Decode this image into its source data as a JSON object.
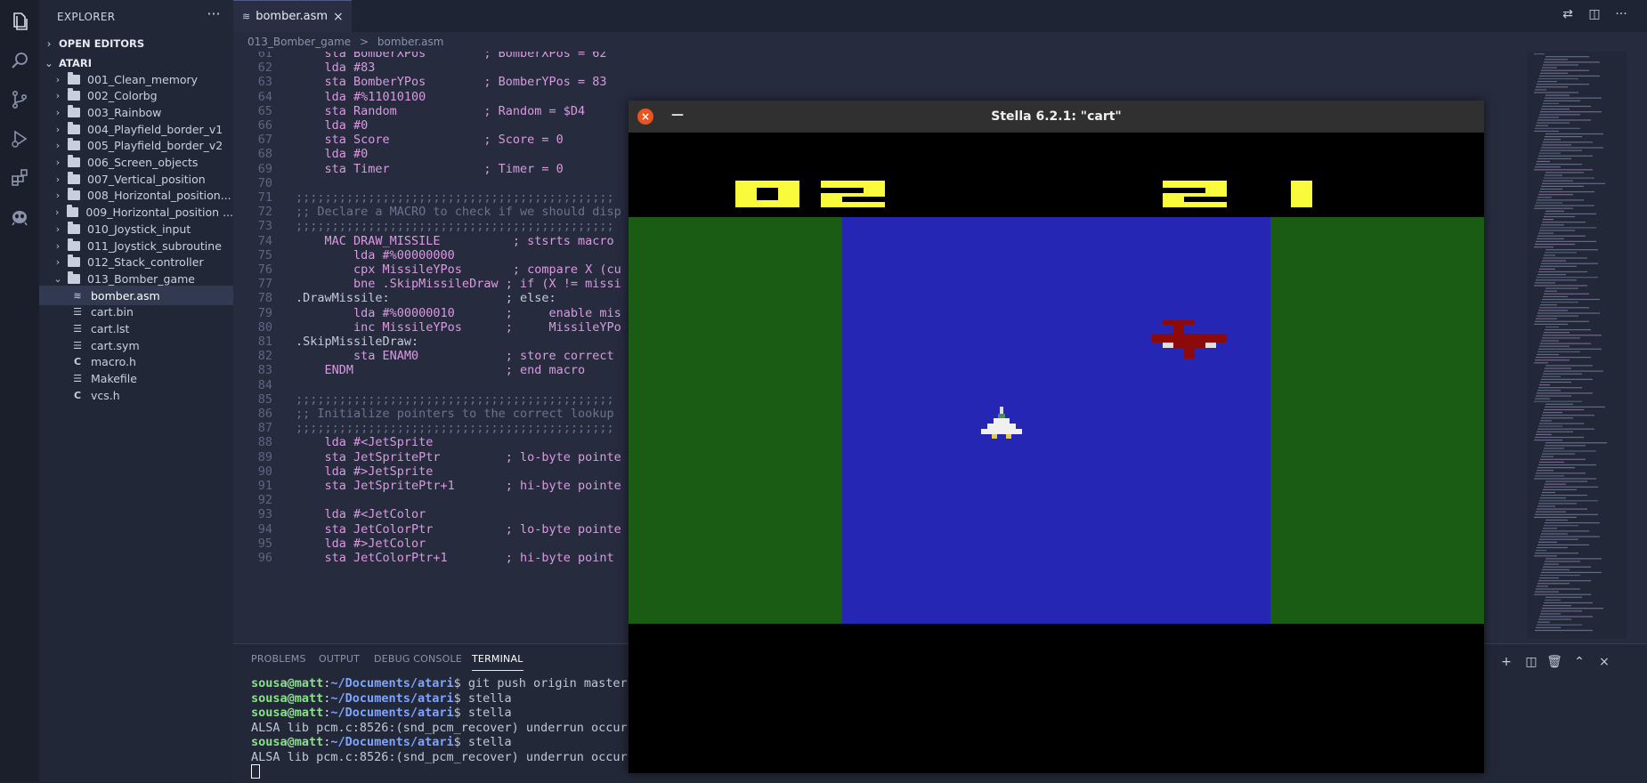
{
  "activity_bar": {
    "icons": [
      "explorer-icon",
      "search-icon",
      "source-control-icon",
      "run-debug-icon",
      "extensions-icon",
      "alien-icon"
    ]
  },
  "explorer": {
    "title": "EXPLORER",
    "more": "···",
    "open_editors": "OPEN EDITORS",
    "workspace": "ATARI",
    "folders": [
      "001_Clean_memory",
      "002_Colorbg",
      "003_Rainbow",
      "004_Playfield_border_v1",
      "005_Playfield_border_v2",
      "006_Screen_objects",
      "007_Vertical_position",
      "008_Horizontal_position...",
      "009_Horizontal_position ...",
      "010_Joystick_input",
      "011_Joystick_subroutine",
      "012_Stack_controller",
      "013_Bomber_game"
    ],
    "files": [
      "bomber.asm",
      "cart.bin",
      "cart.lst",
      "cart.sym",
      "macro.h",
      "Makefile",
      "vcs.h"
    ],
    "file_icons": [
      "asm-icon",
      "lines-icon",
      "lines-icon",
      "lines-icon",
      "c-icon",
      "lines-icon",
      "c-icon"
    ]
  },
  "editor": {
    "tab_label": "bomber.asm",
    "breadcrumb": [
      "013_Bomber_game",
      ">",
      "bomber.asm"
    ]
  },
  "code_lines": [
    {
      "n": "61",
      "t": "    sta BomberXPos        ; BomberXPos = 62"
    },
    {
      "n": "62",
      "t": "    lda #83"
    },
    {
      "n": "63",
      "t": "    sta BomberYPos        ; BomberYPos = 83"
    },
    {
      "n": "64",
      "t": "    lda #%11010100"
    },
    {
      "n": "65",
      "t": "    sta Random            ; Random = $D4"
    },
    {
      "n": "66",
      "t": "    lda #0"
    },
    {
      "n": "67",
      "t": "    sta Score             ; Score = 0"
    },
    {
      "n": "68",
      "t": "    lda #0"
    },
    {
      "n": "69",
      "t": "    sta Timer             ; Timer = 0"
    },
    {
      "n": "70",
      "t": ""
    },
    {
      "n": "71",
      "t": ";;;;;;;;;;;;;;;;;;;;;;;;;;;;;;;;;;;;;;;;;;;;"
    },
    {
      "n": "72",
      "t": ";; Declare a MACRO to check if we should disp"
    },
    {
      "n": "73",
      "t": ";;;;;;;;;;;;;;;;;;;;;;;;;;;;;;;;;;;;;;;;;;;;"
    },
    {
      "n": "74",
      "t": "    MAC DRAW_MISSILE          ; stsrts macro"
    },
    {
      "n": "75",
      "t": "        lda #%00000000"
    },
    {
      "n": "76",
      "t": "        cpx MissileYPos       ; compare X (cu"
    },
    {
      "n": "77",
      "t": "        bne .SkipMissileDraw ; if (X != missi"
    },
    {
      "n": "78",
      "t": ".DrawMissile:                ; else:"
    },
    {
      "n": "79",
      "t": "        lda #%00000010       ;     enable mis"
    },
    {
      "n": "80",
      "t": "        inc MissileYPos      ;     MissileYPo"
    },
    {
      "n": "81",
      "t": ".SkipMissileDraw:"
    },
    {
      "n": "82",
      "t": "        sta ENAM0            ; store correct"
    },
    {
      "n": "83",
      "t": "    ENDM                     ; end macro"
    },
    {
      "n": "84",
      "t": ""
    },
    {
      "n": "85",
      "t": ";;;;;;;;;;;;;;;;;;;;;;;;;;;;;;;;;;;;;;;;;;;;"
    },
    {
      "n": "86",
      "t": ";; Initialize pointers to the correct lookup"
    },
    {
      "n": "87",
      "t": ";;;;;;;;;;;;;;;;;;;;;;;;;;;;;;;;;;;;;;;;;;;;"
    },
    {
      "n": "88",
      "t": "    lda #<JetSprite"
    },
    {
      "n": "89",
      "t": "    sta JetSpritePtr         ; lo-byte pointe"
    },
    {
      "n": "90",
      "t": "    lda #>JetSprite"
    },
    {
      "n": "91",
      "t": "    sta JetSpritePtr+1       ; hi-byte pointe"
    },
    {
      "n": "92",
      "t": ""
    },
    {
      "n": "93",
      "t": "    lda #<JetColor"
    },
    {
      "n": "94",
      "t": "    sta JetColorPtr          ; lo-byte pointe"
    },
    {
      "n": "95",
      "t": "    lda #>JetColor"
    },
    {
      "n": "96",
      "t": "    sta JetColorPtr+1        ; hi-byte point"
    }
  ],
  "panel": {
    "tabs": [
      "PROBLEMS",
      "OUTPUT",
      "DEBUG CONSOLE",
      "TERMINAL"
    ],
    "active_tab": "TERMINAL",
    "terminal": [
      {
        "user": "sousa@matt",
        "path": "~/Documents/atari",
        "cmd": "$ git push origin master"
      },
      {
        "user": "sousa@matt",
        "path": "~/Documents/atari",
        "cmd": "$ stella"
      },
      {
        "user": "sousa@matt",
        "path": "~/Documents/atari",
        "cmd": "$ stella"
      },
      {
        "user": "",
        "path": "",
        "cmd": "ALSA lib pcm.c:8526:(snd_pcm_recover) underrun occurr"
      },
      {
        "user": "sousa@matt",
        "path": "~/Documents/atari",
        "cmd": "$ stella"
      },
      {
        "user": "",
        "path": "",
        "cmd": "ALSA lib pcm.c:8526:(snd_pcm_recover) underrun occurr"
      }
    ]
  },
  "stella": {
    "title": "Stella 6.2.1: \"cart\"",
    "score": "02",
    "timer": "21",
    "colors": {
      "grass": "#1a5c14",
      "river": "#2626b4",
      "digits": "#fafa3c",
      "bomber": "#8c0a0a",
      "jet": "#f0f0f0"
    }
  }
}
